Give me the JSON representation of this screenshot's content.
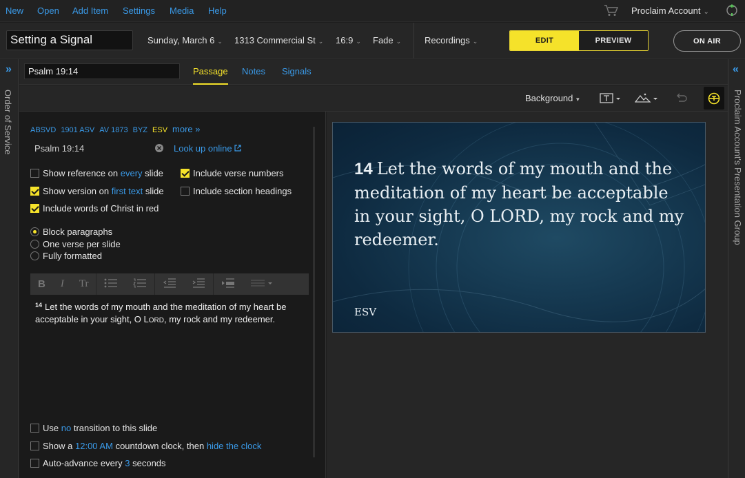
{
  "menu": {
    "items": [
      "New",
      "Open",
      "Add Item",
      "Settings",
      "Media",
      "Help"
    ],
    "account": "Proclaim Account"
  },
  "toolbar": {
    "title": "Setting a Signal",
    "date": "Sunday, March 6",
    "location": "1313 Commercial St",
    "aspect": "16:9",
    "transition": "Fade",
    "recordings": "Recordings",
    "edit": "EDIT",
    "preview": "PREVIEW",
    "on_air": "ON AIR"
  },
  "rails": {
    "left_label": "Order of Service",
    "right_label": "Proclaim Account's Presentation Group"
  },
  "tabs": {
    "reference": "Psalm 19:14",
    "items": [
      "Passage",
      "Notes",
      "Signals"
    ]
  },
  "edit_tools": {
    "background": "Background"
  },
  "passage": {
    "versions": [
      "ABSVD",
      "1901 ASV",
      "AV 1873",
      "BYZ",
      "ESV"
    ],
    "selected_version": "ESV",
    "more": "more »",
    "reference": "Psalm 19:14",
    "lookup": "Look up online",
    "options": {
      "show_reference_pre": "Show reference on",
      "show_reference_link": "every",
      "show_reference_post": "slide",
      "include_verse_numbers": "Include verse numbers",
      "show_version_pre": "Show version on",
      "show_version_link": "first text",
      "show_version_post": "slide",
      "include_section_headings": "Include section headings",
      "words_of_christ": "Include words of Christ in red"
    },
    "layout": [
      "Block paragraphs",
      "One verse per slide",
      "Fully formatted"
    ],
    "verse_number": "14",
    "text_a": "Let the words of my mouth and the meditation of my heart be acceptable in your sight, O L",
    "text_small_caps": "ORD",
    "text_b": ", my rock and my redeemer.",
    "bottom": {
      "transition_pre": "Use",
      "transition_link": "no",
      "transition_post": "transition to this slide",
      "countdown_pre": "Show a",
      "countdown_time": "12:00 AM",
      "countdown_mid": "countdown clock, then",
      "countdown_link": "hide the clock",
      "advance_pre": "Auto-advance every",
      "advance_num": "3",
      "advance_post": "seconds"
    }
  },
  "slide": {
    "verse_number": "14",
    "text": "Let the words of my mouth and the meditation of my heart be acceptable in your sight, O LORD, my rock and my redeemer.",
    "version": "ESV"
  },
  "colors": {
    "accent": "#f5e22a",
    "link": "#3a9ae8",
    "background": "#1e1e1e"
  }
}
